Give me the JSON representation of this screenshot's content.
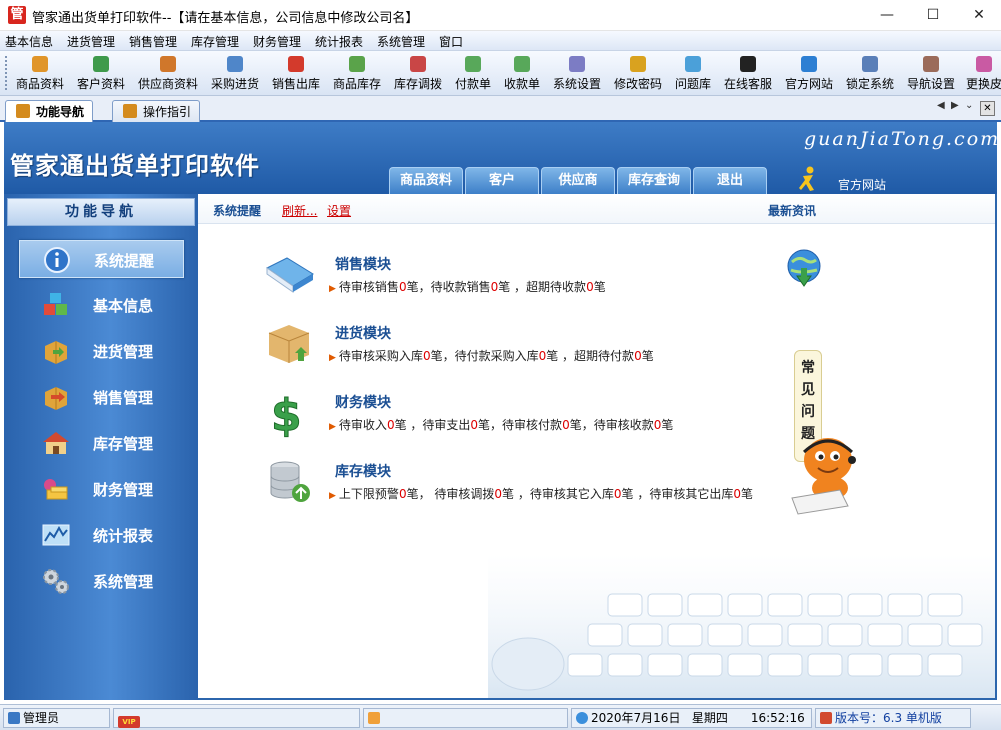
{
  "window": {
    "title": "管家通出货单打印软件--【请在基本信息，公司信息中修改公司名】",
    "logo_char": "管",
    "min_glyph": "—",
    "max_glyph": "☐",
    "close_glyph": "✕"
  },
  "menu": [
    "基本信息",
    "进货管理",
    "销售管理",
    "库存管理",
    "财务管理",
    "统计报表",
    "系统管理",
    "窗口"
  ],
  "toolbar": [
    {
      "label": "商品资料",
      "icon": "goods-icon",
      "color": "#e0952a"
    },
    {
      "label": "客户资料",
      "icon": "customer-icon",
      "color": "#3f9a4c"
    },
    {
      "label": "供应商资料",
      "icon": "supplier-icon",
      "color": "#d0772b"
    },
    {
      "label": "采购进货",
      "icon": "purchase-icon",
      "color": "#4f86c9"
    },
    {
      "label": "销售出库",
      "icon": "sales-out-icon",
      "color": "#d33a2c"
    },
    {
      "label": "商品库存",
      "icon": "stock-icon",
      "color": "#5aa34a"
    },
    {
      "label": "库存调拨",
      "icon": "transfer-icon",
      "color": "#c94646"
    },
    {
      "label": "付款单",
      "icon": "payment-icon",
      "color": "#58a85a"
    },
    {
      "label": "收款单",
      "icon": "receipt-icon",
      "color": "#58a85a"
    },
    {
      "label": "系统设置",
      "icon": "settings-icon",
      "color": "#7c7cc4"
    },
    {
      "label": "修改密码",
      "icon": "password-icon",
      "color": "#d9a21f"
    },
    {
      "label": "问题库",
      "icon": "faq-icon",
      "color": "#4ba0d9"
    },
    {
      "label": "在线客服",
      "icon": "qq-icon",
      "color": "#222222"
    },
    {
      "label": "官方网站",
      "icon": "ie-icon",
      "color": "#2d7fd3"
    },
    {
      "label": "锁定系统",
      "icon": "lock-icon",
      "color": "#5a7fb8"
    },
    {
      "label": "导航设置",
      "icon": "nav-settings-icon",
      "color": "#9b6b5a"
    },
    {
      "label": "更换皮",
      "icon": "skin-icon",
      "color": "#c95aa3"
    }
  ],
  "tabs": [
    {
      "label": "功能导航",
      "active": true
    },
    {
      "label": "操作指引",
      "active": false
    }
  ],
  "tab_controls": {
    "prev": "◀",
    "next": "▶",
    "list": "⌄",
    "close": "✕"
  },
  "header": {
    "brand": "管家通出货单打印软件",
    "domain": "guanJiaTong.com",
    "tabs": [
      "商品资料",
      "客户",
      "供应商",
      "库存查询",
      "退出"
    ],
    "site_label": "官方网站"
  },
  "sidebar": {
    "title": "功能导航",
    "items": [
      {
        "label": "系统提醒",
        "icon": "info-icon",
        "active": true
      },
      {
        "label": "基本信息",
        "icon": "cubes-icon",
        "active": false
      },
      {
        "label": "进货管理",
        "icon": "box-in-icon",
        "active": false
      },
      {
        "label": "销售管理",
        "icon": "box-out-icon",
        "active": false
      },
      {
        "label": "库存管理",
        "icon": "warehouse-icon",
        "active": false
      },
      {
        "label": "财务管理",
        "icon": "money-icon",
        "active": false
      },
      {
        "label": "统计报表",
        "icon": "chart-icon",
        "active": false
      },
      {
        "label": "系统管理",
        "icon": "gears-icon",
        "active": false
      }
    ]
  },
  "content": {
    "reminder_title": "系统提醒",
    "refresh_link": "刷新...",
    "settings_link": "设置",
    "news_title": "最新资讯",
    "faq_text": [
      "常",
      "见",
      "问",
      "题"
    ],
    "modules": [
      {
        "title": "销售模块",
        "parts": [
          "待审核销售",
          "0",
          "笔，待收款销售",
          "0",
          "笔 ，超期待收款",
          "0",
          "笔"
        ]
      },
      {
        "title": "进货模块",
        "parts": [
          "待审核采购入库",
          "0",
          "笔，待付款采购入库",
          "0",
          "笔 ，超期待付款",
          "0",
          "笔"
        ]
      },
      {
        "title": "财务模块",
        "parts": [
          "待审收入",
          "0",
          "笔 ，待审支出",
          "0",
          "笔，待审核付款",
          "0",
          "笔，待审核收款",
          "0",
          "笔"
        ]
      },
      {
        "title": "库存模块",
        "parts": [
          "上下限预警",
          "0",
          "笔， 待审核调拨",
          "0",
          "笔 ，待审核其它入库",
          "0",
          "笔 ，待审核其它出库",
          "0",
          "笔"
        ]
      }
    ]
  },
  "status": {
    "user": "管理员",
    "vip": "VIP",
    "date": "2020年7月16日",
    "weekday": "星期四",
    "time": "16:52:16",
    "version": "版本号：6.3 单机版"
  }
}
